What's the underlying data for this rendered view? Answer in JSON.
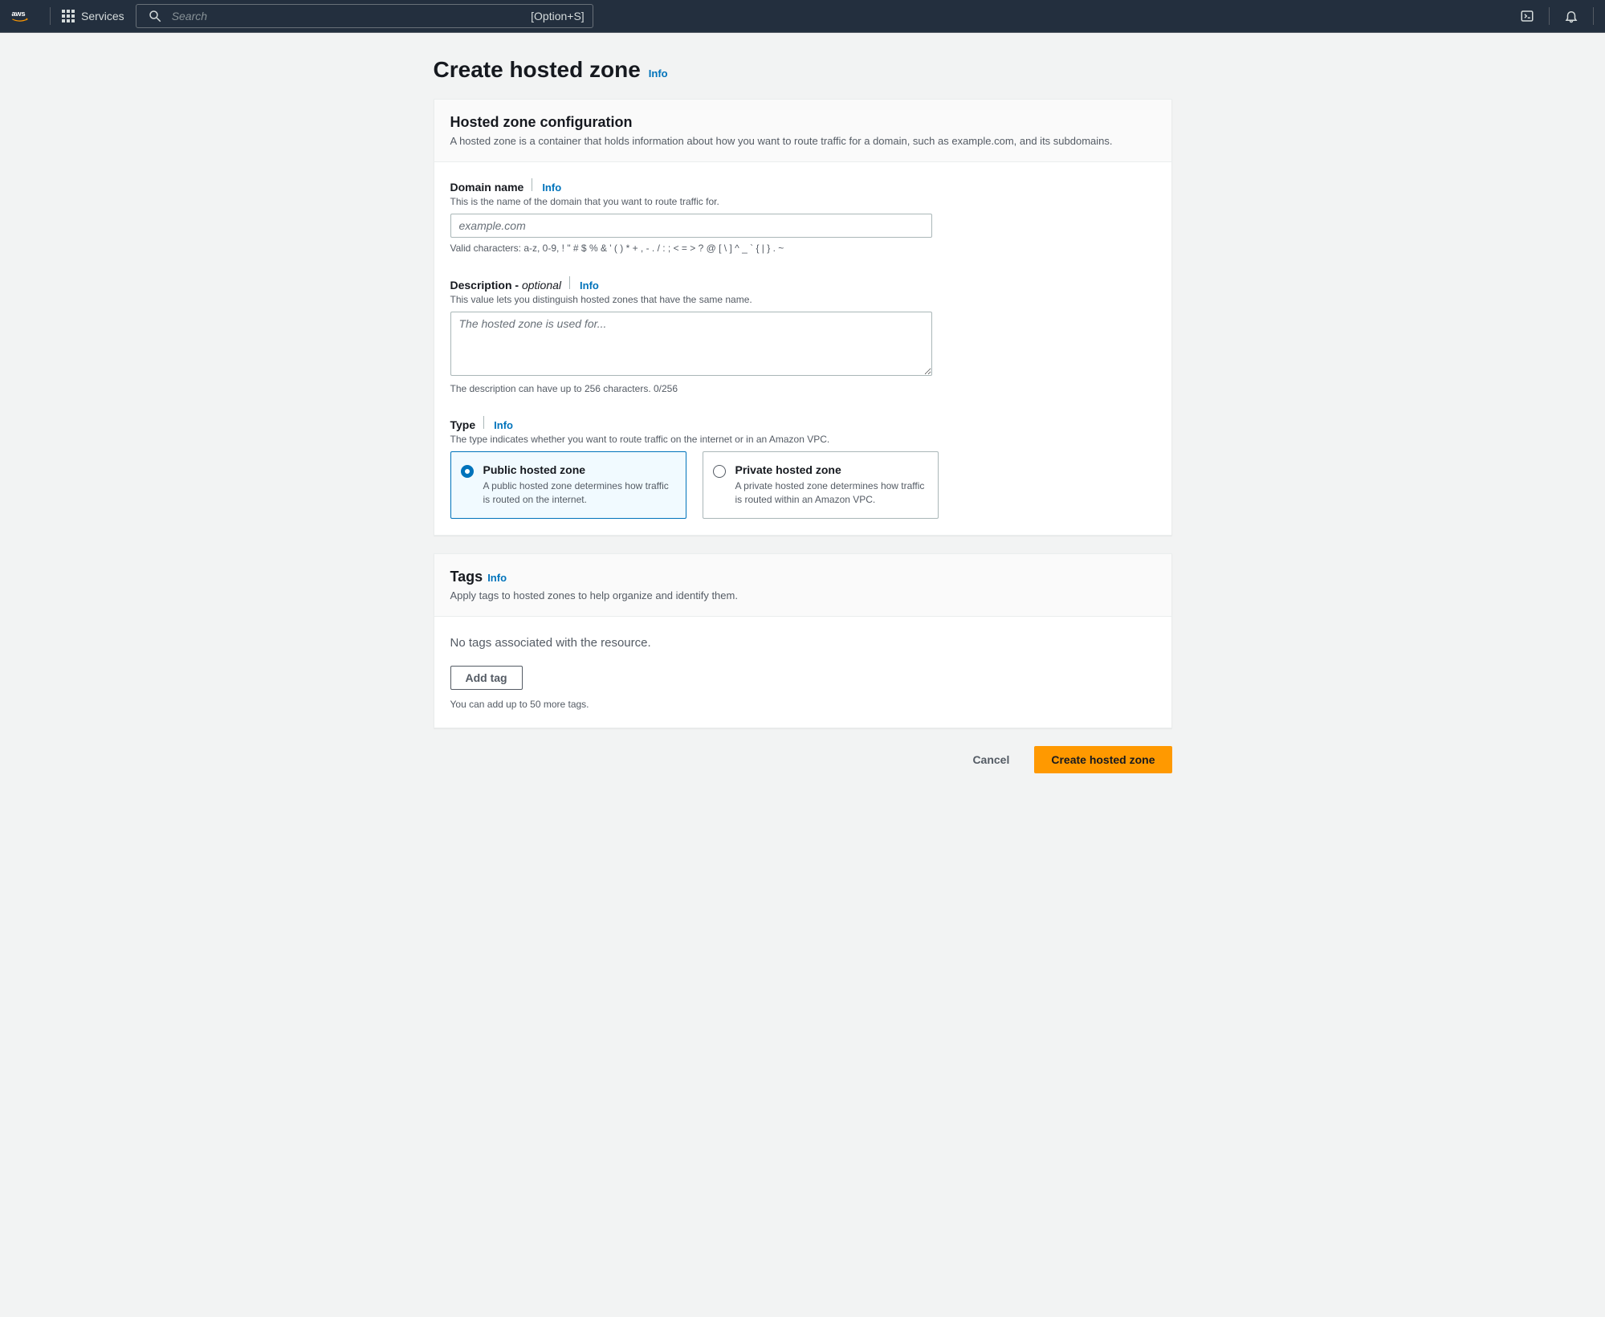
{
  "nav": {
    "services_label": "Services",
    "search_placeholder": "Search",
    "search_shortcut": "[Option+S]"
  },
  "page": {
    "title": "Create hosted zone",
    "info": "Info"
  },
  "config_panel": {
    "title": "Hosted zone configuration",
    "subtitle": "A hosted zone is a container that holds information about how you want to route traffic for a domain, such as example.com, and its subdomains."
  },
  "domain": {
    "label": "Domain name",
    "info": "Info",
    "desc": "This is the name of the domain that you want to route traffic for.",
    "placeholder": "example.com",
    "help": "Valid characters: a-z, 0-9, ! \" # $ % & ' ( ) * + , - . / : ; < = > ? @ [ \\ ] ^ _ ` { | } . ~"
  },
  "description": {
    "label_prefix": "Description - ",
    "label_suffix": "optional",
    "info": "Info",
    "desc": "This value lets you distinguish hosted zones that have the same name.",
    "placeholder": "The hosted zone is used for...",
    "help": "The description can have up to 256 characters. 0/256"
  },
  "type": {
    "label": "Type",
    "info": "Info",
    "desc": "The type indicates whether you want to route traffic on the internet or in an Amazon VPC.",
    "public_title": "Public hosted zone",
    "public_desc": "A public hosted zone determines how traffic is routed on the internet.",
    "private_title": "Private hosted zone",
    "private_desc": "A private hosted zone determines how traffic is routed within an Amazon VPC."
  },
  "tags": {
    "title": "Tags",
    "info": "Info",
    "subtitle": "Apply tags to hosted zones to help organize and identify them.",
    "empty": "No tags associated with the resource.",
    "add": "Add tag",
    "help": "You can add up to 50 more tags."
  },
  "actions": {
    "cancel": "Cancel",
    "create": "Create hosted zone"
  }
}
